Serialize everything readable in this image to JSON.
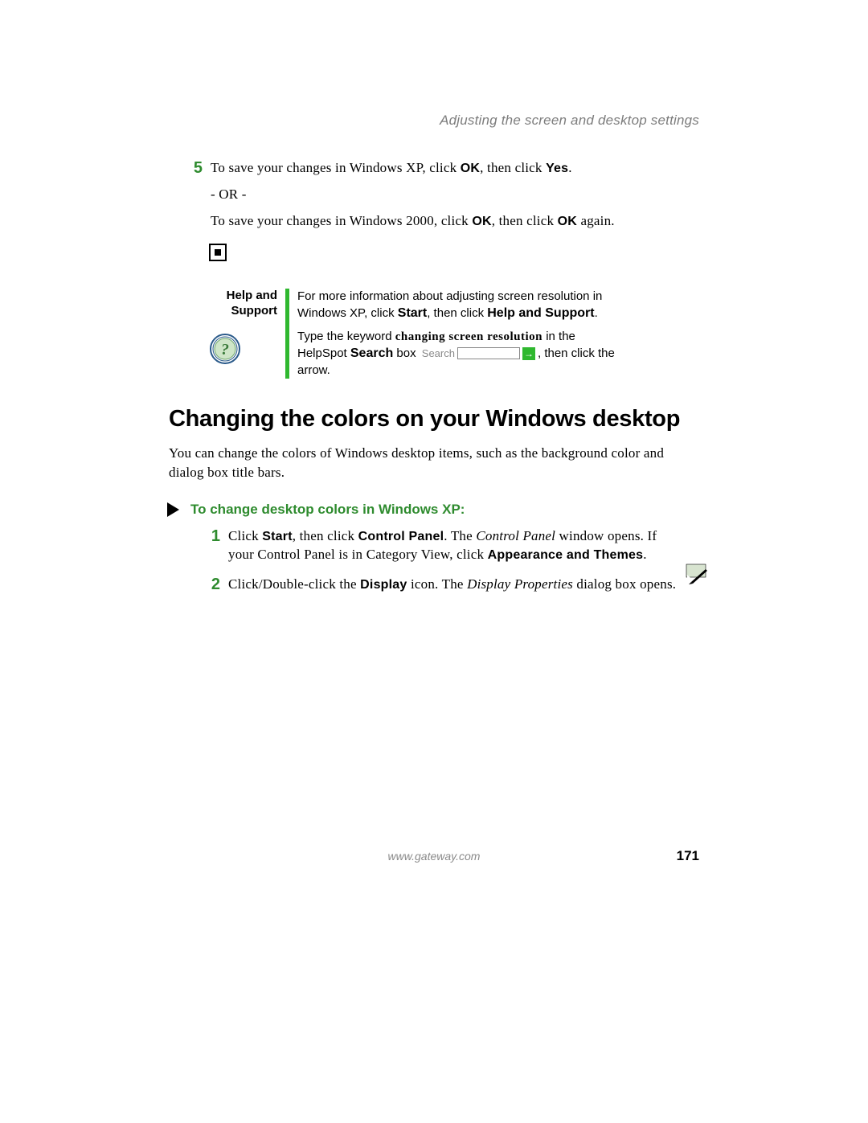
{
  "header": {
    "section_title": "Adjusting the screen and desktop settings"
  },
  "step5": {
    "num": "5",
    "xp_prefix": "To save your changes in Windows XP, click ",
    "ok": "OK",
    "then_click": ", then click ",
    "yes": "Yes",
    "period": ".",
    "or": "- OR -",
    "w2k_prefix": "To save your changes in Windows 2000, click ",
    "again": " again."
  },
  "help": {
    "label_line1": "Help and",
    "label_line2": "Support",
    "line1a": "For more information about adjusting screen resolution in Windows XP, click ",
    "start": "Start",
    "line1b": ", then click ",
    "hs": "Help and Support",
    "line1c": ".",
    "line2a": "Type the keyword ",
    "keyword": "changing screen resolution",
    "line2b": " in the HelpSpot ",
    "search_bold": "Search",
    "line2c": " box ",
    "search_label": "Search",
    "line2d": ", then click the arrow."
  },
  "section": {
    "heading": "Changing the colors on your Windows desktop",
    "intro": "You can change the colors of Windows desktop items, such as the background color and dialog box title bars."
  },
  "proc": {
    "title": "To change desktop colors in Windows XP:",
    "s1": {
      "num": "1",
      "a": "Click ",
      "start": "Start",
      "b": ", then click ",
      "cp": "Control Panel",
      "c": ". The ",
      "cpi": "Control Panel",
      "d": " window opens. If your Control Panel is in Category View, click ",
      "at": "Appearance and Themes",
      "e": "."
    },
    "s2": {
      "num": "2",
      "a": "Click/Double-click the ",
      "display": "Display",
      "b": " icon. The ",
      "dp": "Display Properties",
      "c": " dialog box opens."
    }
  },
  "footer": {
    "url": "www.gateway.com",
    "page": "171"
  }
}
